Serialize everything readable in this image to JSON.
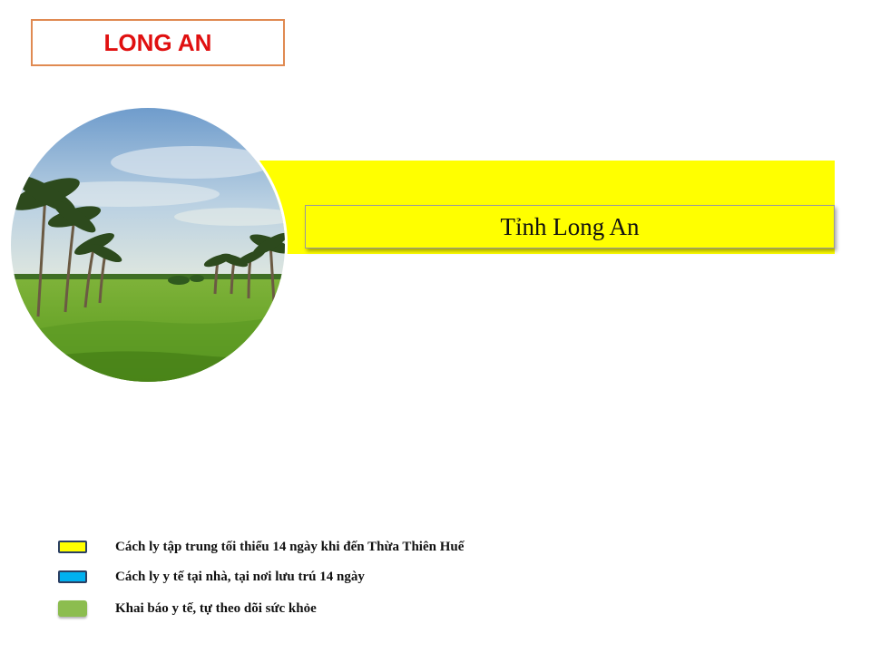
{
  "title": "LONG AN",
  "province_label": "Tỉnh Long An",
  "photo": {
    "subject": "rice-field-with-palm-trees"
  },
  "legend": [
    {
      "label": "Cách ly tập trung tối thiểu  14 ngày khi đến Thừa Thiên Huế",
      "color": "#ffff00"
    },
    {
      "label": "Cách ly y tế tại nhà, tại nơi lưu trú  14 ngày",
      "color": "#00b0f0"
    },
    {
      "label": "Khai báo y tế, tự theo dõi sức khỏe",
      "color": "#8cbd4f"
    }
  ],
  "colors": {
    "title_text": "#e01010",
    "title_border": "#e08a52",
    "band": "#ffff00"
  }
}
